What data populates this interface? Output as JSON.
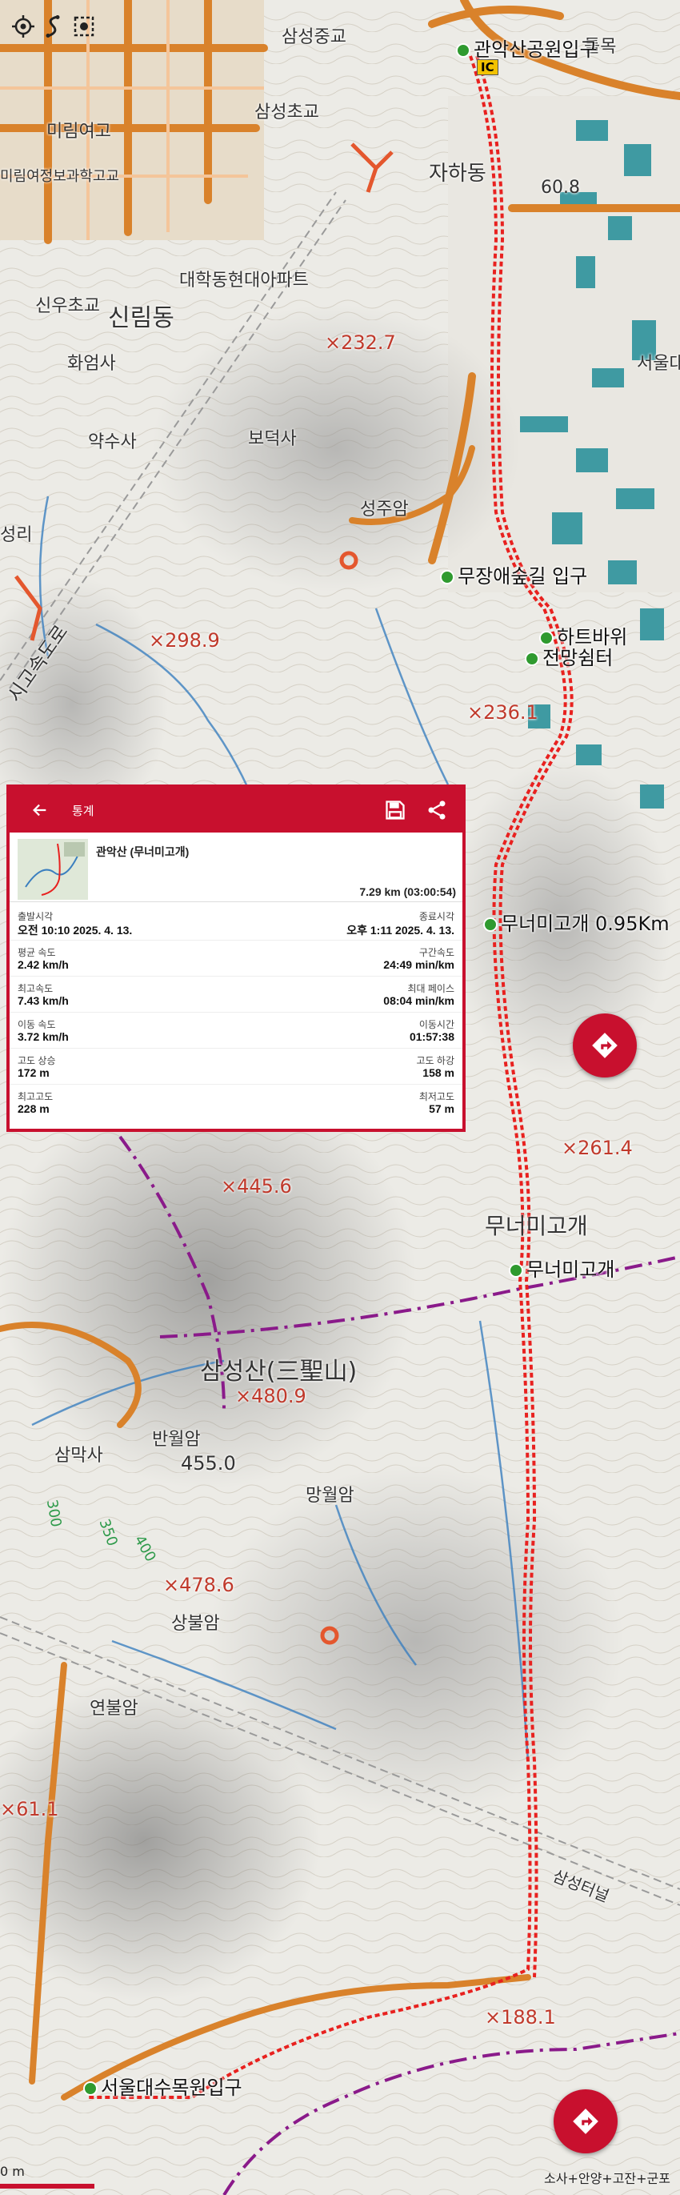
{
  "map": {
    "pois": [
      {
        "label": "관악산공원입구"
      },
      {
        "label": "무장애숲길 입구"
      },
      {
        "label": "하트바위"
      },
      {
        "label": "전망쉼터"
      },
      {
        "label": "무너미고개 0.95Km"
      },
      {
        "label": "무너미고개"
      },
      {
        "label": "서울대수목원입구"
      }
    ],
    "spot_heights": [
      "232.7",
      "298.9",
      "236.1",
      "261.4",
      "445.6",
      "480.9",
      "478.6",
      "188.1",
      "60.8",
      "61.1"
    ],
    "summit": "455.0",
    "town_labels": [
      "신림동",
      "자하동",
      "미림여고",
      "삼성중교",
      "삼성초교",
      "대학동현대아파트",
      "신우초교",
      "화엄사",
      "약수사",
      "보덕사",
      "성주암",
      "삼막사",
      "반월암",
      "상불암",
      "망월암",
      "연불암",
      "삼성산(三聖山)",
      "무너미고개",
      "서울대",
      "삼성터널",
      "시고속도로",
      "미림여정보과학고교",
      "IC",
      "틀목",
      "성리"
    ],
    "contours": [
      "300",
      "350",
      "400"
    ]
  },
  "toolbar": {
    "icons": [
      "gps-crosshair-icon",
      "route-icon",
      "focus-frame-icon"
    ]
  },
  "panel": {
    "title": "통계",
    "track_name": "관악산 (무너미고개)",
    "distance": "7.29 km (03:00:54)",
    "stats": [
      {
        "left_key": "출발시각",
        "left_val": "오전 10:10 2025. 4. 13.",
        "right_key": "종료시각",
        "right_val": "오후 1:11 2025. 4. 13."
      },
      {
        "left_key": "평균 속도",
        "left_val": "2.42 km/h",
        "right_key": "구간속도",
        "right_val": "24:49 min/km"
      },
      {
        "left_key": "최고속도",
        "left_val": "7.43 km/h",
        "right_key": "최대 페이스",
        "right_val": "08:04 min/km"
      },
      {
        "left_key": "이동 속도",
        "left_val": "3.72 km/h",
        "right_key": "이동시간",
        "right_val": "01:57:38"
      },
      {
        "left_key": "고도 상승",
        "left_val": "172 m",
        "right_key": "고도 하강",
        "right_val": "158 m"
      },
      {
        "left_key": "최고고도",
        "left_val": "228 m",
        "right_key": "최저고도",
        "right_val": "57 m"
      }
    ]
  },
  "scale": {
    "label": "0 m"
  },
  "credit": "소사+안양+고잔+군포",
  "colors": {
    "accent": "#c8102e",
    "route": "#e8211f",
    "poi": "#2f9a2f",
    "road": "#d9822b",
    "water": "#3b7fbf",
    "boundary": "#8a1a8a"
  }
}
